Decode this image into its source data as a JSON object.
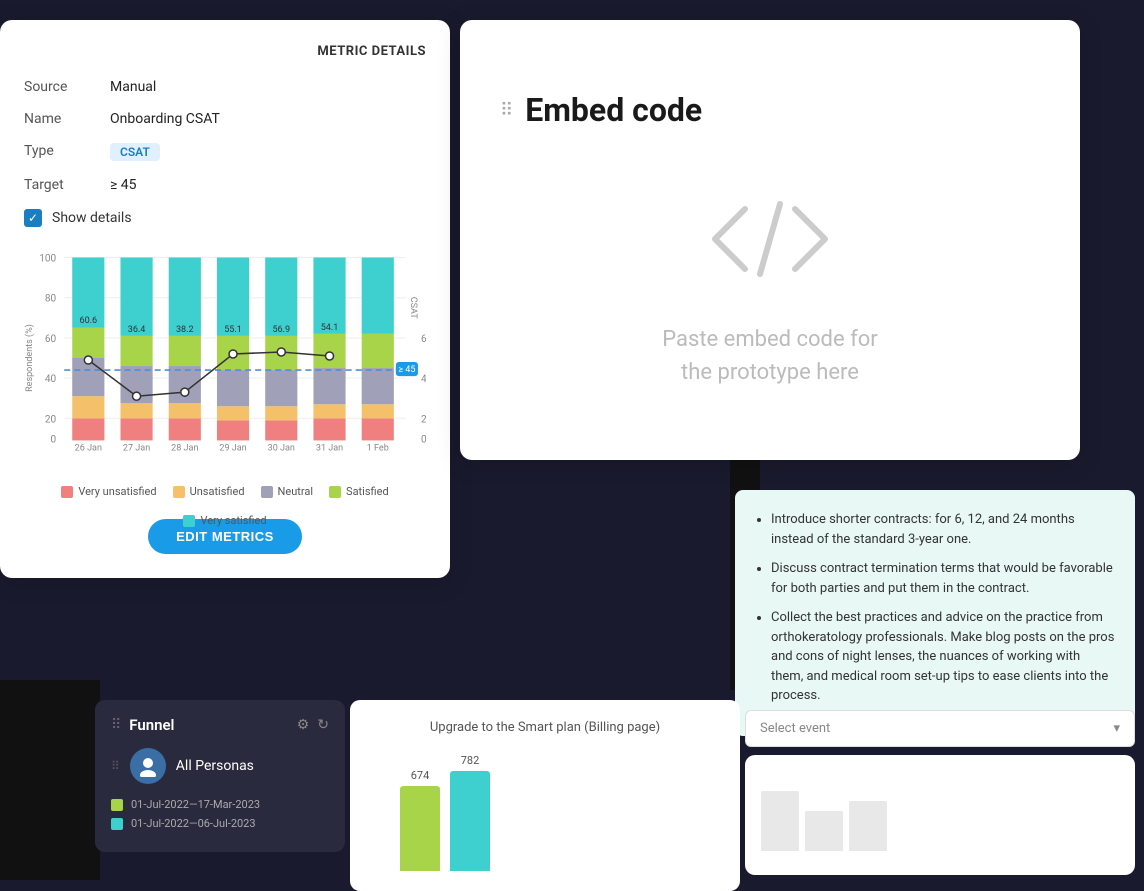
{
  "metric": {
    "title": "METRIC DETAILS",
    "source_label": "Source",
    "source_value": "Manual",
    "name_label": "Name",
    "name_value": "Onboarding CSAT",
    "type_label": "Type",
    "type_badge": "CSAT",
    "target_label": "Target",
    "target_value": "≥ 45",
    "show_details_label": "Show details"
  },
  "chart": {
    "y_label": "Respondents (%)",
    "y_right_label": "CSAT",
    "dates": [
      "26 Jan",
      "27 Jan",
      "28 Jan",
      "29 Jan",
      "30 Jan",
      "31 Jan",
      "1 Feb"
    ],
    "csat_values": [
      60.6,
      36.4,
      38.2,
      55.1,
      56.9,
      54.1,
      null
    ],
    "target_line": "≥ 45",
    "legend": [
      {
        "label": "Very unsatisfied",
        "color": "#f08080"
      },
      {
        "label": "Unsatisfied",
        "color": "#f5c06a"
      },
      {
        "label": "Neutral",
        "color": "#a0a0b8"
      },
      {
        "label": "Satisfied",
        "color": "#a8d44a"
      },
      {
        "label": "Very satisfied",
        "color": "#3ecfcf"
      }
    ]
  },
  "edit_button": "EDIT METRICS",
  "embed": {
    "drag_icon": "⠿",
    "title": "Embed code",
    "placeholder": "Paste embed code for\nthe prototype here"
  },
  "bullets": {
    "items": [
      "Introduce shorter contracts: for 6, 12, and 24 months instead of the standard 3-year one.",
      "Discuss contract termination terms that would be favorable for both parties and put them in the contract.",
      "Collect the best practices and advice on the practice from orthokeratology professionals. Make blog posts on the pros and cons of night lenses, the nuances of working with them, and medical room set-up tips to ease clients into the process."
    ]
  },
  "funnel": {
    "drag_icon": "⠿",
    "title": "Funnel",
    "persona": "All Personas",
    "legend": [
      {
        "label": "01-Jul-2022—17-Mar-2023",
        "color": "#a8d44a"
      },
      {
        "label": "01-Jul-2022—06-Jul-2023",
        "color": "#3ecfcf"
      }
    ]
  },
  "billing": {
    "title": "Upgrade to the Smart plan (Billing page)",
    "bars": [
      {
        "value": 674,
        "color": "#a8d44a",
        "height": 80
      },
      {
        "value": 782,
        "color": "#3ecfcf",
        "height": 95
      }
    ],
    "select_placeholder": "Select event"
  }
}
